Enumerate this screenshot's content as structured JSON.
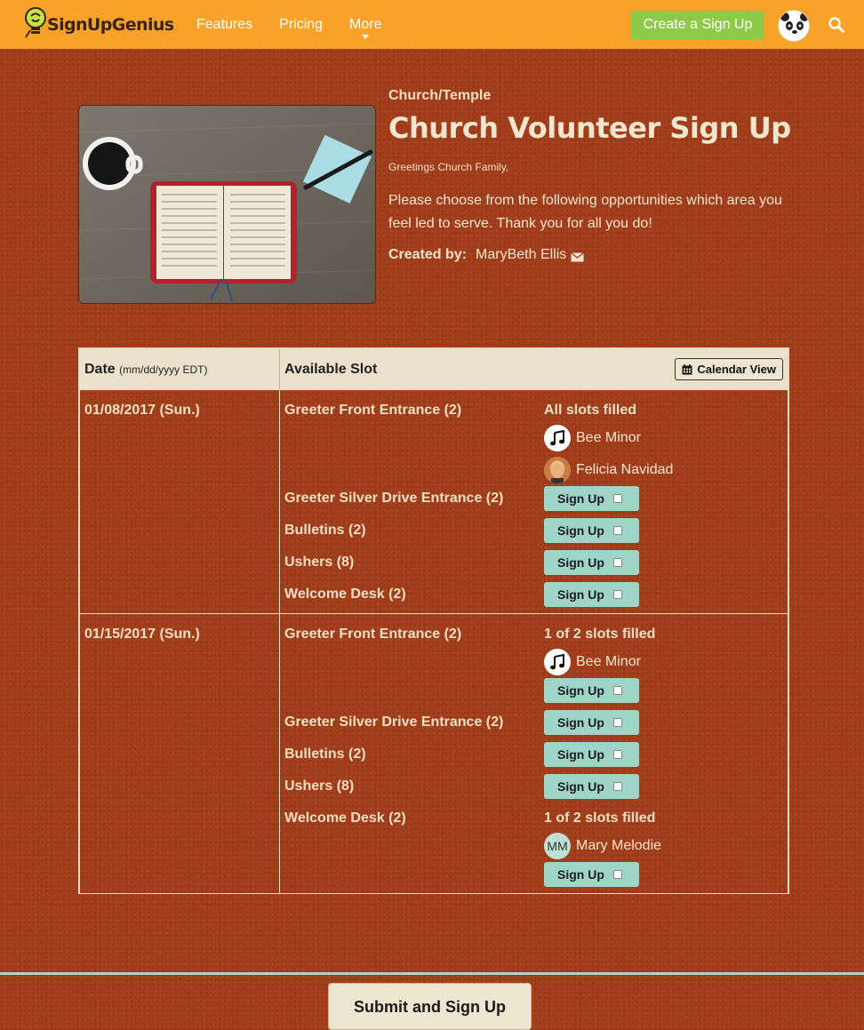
{
  "nav": {
    "logo_text": "SignUpGenius",
    "links": [
      "Features",
      "Pricing",
      "More"
    ],
    "create_label": "Create a Sign Up",
    "colors": {
      "bar": "#f8a22a",
      "create": "#8fc94a"
    }
  },
  "header": {
    "category": "Church/Temple",
    "title": "Church Volunteer Sign Up",
    "greeting": "Greetings Church Family,",
    "description": "Please choose from the following opportunities which area you feel led to serve.  Thank you for all you do!",
    "created_label": "Created by:",
    "created_name": "MaryBeth Ellis"
  },
  "table": {
    "date_header": "Date",
    "date_header_sub": "(mm/dd/yyyy EDT)",
    "slot_header": "Available Slot",
    "calendar_label": "Calendar View",
    "signup_label": "Sign Up",
    "groups": [
      {
        "date": "01/08/2017 (Sun.)",
        "slots": [
          {
            "name": "Greeter Front Entrance (2)",
            "status": "All slots filled",
            "people": [
              {
                "name": "Bee Minor",
                "avatar": "music-icon"
              },
              {
                "name": "Felicia Navidad",
                "avatar": "photo"
              }
            ],
            "signup": false
          },
          {
            "name": "Greeter Silver Drive Entrance (2)",
            "status": "",
            "people": [],
            "signup": true
          },
          {
            "name": "Bulletins (2)",
            "status": "",
            "people": [],
            "signup": true
          },
          {
            "name": "Ushers (8)",
            "status": "",
            "people": [],
            "signup": true
          },
          {
            "name": "Welcome Desk (2)",
            "status": "",
            "people": [],
            "signup": true
          }
        ]
      },
      {
        "date": "01/15/2017 (Sun.)",
        "slots": [
          {
            "name": "Greeter Front Entrance (2)",
            "status": "1 of 2 slots filled",
            "people": [
              {
                "name": "Bee Minor",
                "avatar": "music-icon"
              }
            ],
            "signup": true
          },
          {
            "name": "Greeter Silver Drive Entrance (2)",
            "status": "",
            "people": [],
            "signup": true
          },
          {
            "name": "Bulletins (2)",
            "status": "",
            "people": [],
            "signup": true
          },
          {
            "name": "Ushers (8)",
            "status": "",
            "people": [],
            "signup": true
          },
          {
            "name": "Welcome Desk (2)",
            "status": "1 of 2 slots filled",
            "people": [
              {
                "name": "Mary Melodie",
                "avatar": "initials",
                "initials": "MM"
              }
            ],
            "signup": true
          }
        ]
      }
    ]
  },
  "footer": {
    "submit_label": "Submit and Sign Up"
  }
}
